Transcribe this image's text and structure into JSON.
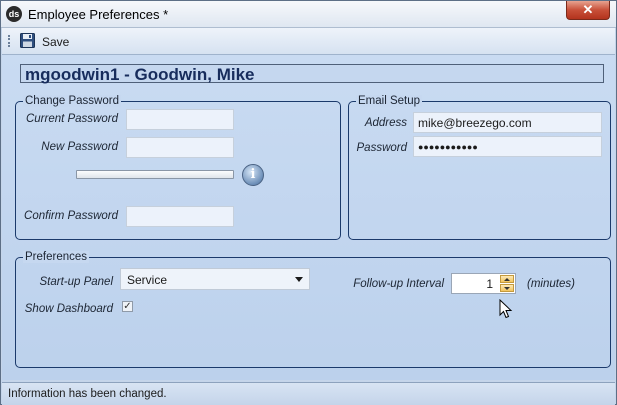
{
  "window": {
    "title": "Employee Preferences *",
    "app_icon": "ds",
    "close_icon": "close-icon"
  },
  "toolbar": {
    "save_label": "Save",
    "save_icon": "floppy-disk-icon"
  },
  "user_header": "mgoodwin1 - Goodwin, Mike",
  "change_password": {
    "legend": "Change Password",
    "current_label": "Current Password",
    "current_value": "",
    "new_label": "New Password",
    "new_value": "",
    "confirm_label": "Confirm Password",
    "confirm_value": "",
    "info_icon": "info-icon"
  },
  "email_setup": {
    "legend": "Email Setup",
    "address_label": "Address",
    "address_value": "mike@breezego.com",
    "password_label": "Password",
    "password_value": "●●●●●●●●●●●"
  },
  "preferences": {
    "legend": "Preferences",
    "startup_label": "Start-up Panel",
    "startup_value": "Service",
    "dashboard_label": "Show Dashboard",
    "dashboard_checked": true,
    "checkmark": "✓",
    "followup_label": "Follow-up Interval",
    "followup_value": "1",
    "followup_unit": "(minutes)"
  },
  "status": {
    "text": "Information has been changed."
  },
  "colors": {
    "accent": "#172c5c",
    "group_border": "#1b3a6b",
    "background": "#c5d5ea"
  }
}
